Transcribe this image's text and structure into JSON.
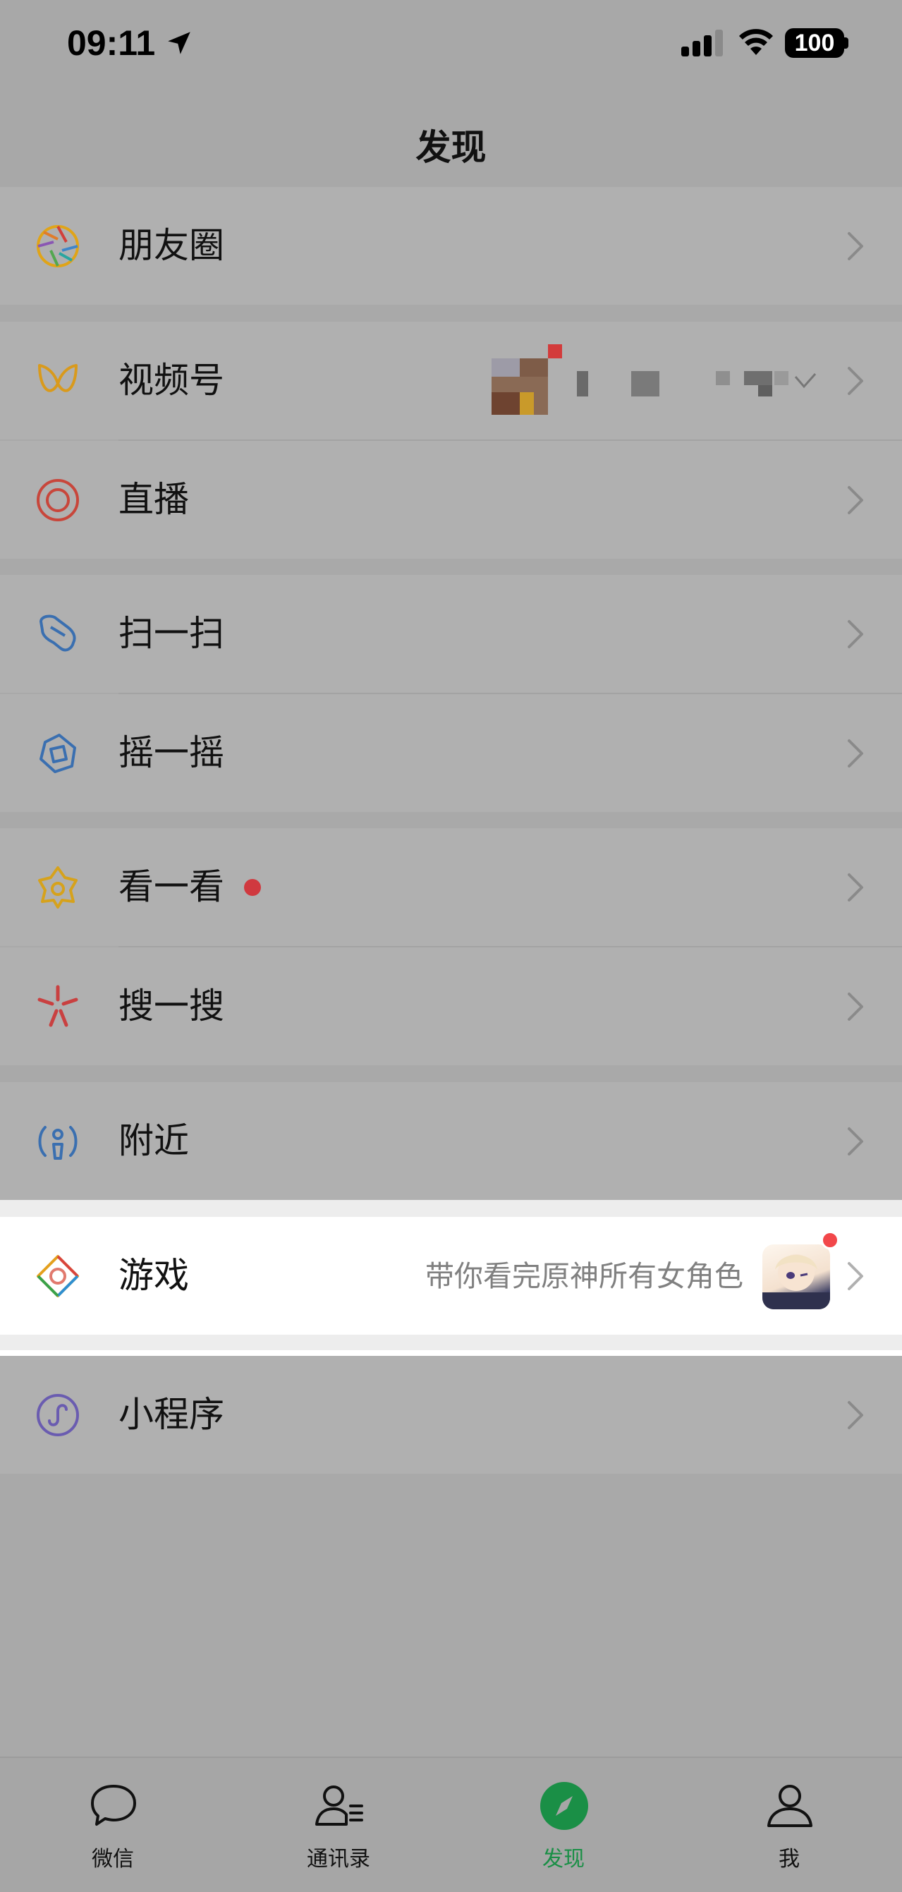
{
  "status_bar": {
    "time": "09:11",
    "battery": "100",
    "icons": [
      "location-arrow-icon",
      "cellular-signal-icon",
      "wifi-icon",
      "battery-icon"
    ]
  },
  "header": {
    "title": "发现"
  },
  "menu": {
    "moments": {
      "label": "朋友圈",
      "icon": "moments-aperture-icon"
    },
    "channels": {
      "label": "视频号",
      "icon": "channels-icon"
    },
    "live": {
      "label": "直播",
      "icon": "live-icon"
    },
    "scan": {
      "label": "扫一扫",
      "icon": "scan-icon"
    },
    "shake": {
      "label": "摇一摇",
      "icon": "shake-icon"
    },
    "top_stories": {
      "label": "看一看",
      "icon": "top-stories-icon",
      "has_dot": true
    },
    "search": {
      "label": "搜一搜",
      "icon": "search-icon"
    },
    "nearby": {
      "label": "附近",
      "icon": "nearby-icon"
    },
    "games": {
      "label": "游戏",
      "icon": "games-icon",
      "subtitle": "带你看完原神所有女角色",
      "has_dot": true
    },
    "mini_programs": {
      "label": "小程序",
      "icon": "mini-programs-icon"
    }
  },
  "tab_bar": {
    "tabs": [
      {
        "label": "微信",
        "icon": "chat-bubble-icon",
        "active": false
      },
      {
        "label": "通讯录",
        "icon": "contacts-icon",
        "active": false
      },
      {
        "label": "发现",
        "icon": "discover-compass-icon",
        "active": true
      },
      {
        "label": "我",
        "icon": "me-person-icon",
        "active": false
      }
    ]
  },
  "colors": {
    "dim_background": "#a9a9a9",
    "highlight_row": "#ffffff",
    "accent_green": "#1a8f46",
    "badge_red": "#d0393f"
  }
}
